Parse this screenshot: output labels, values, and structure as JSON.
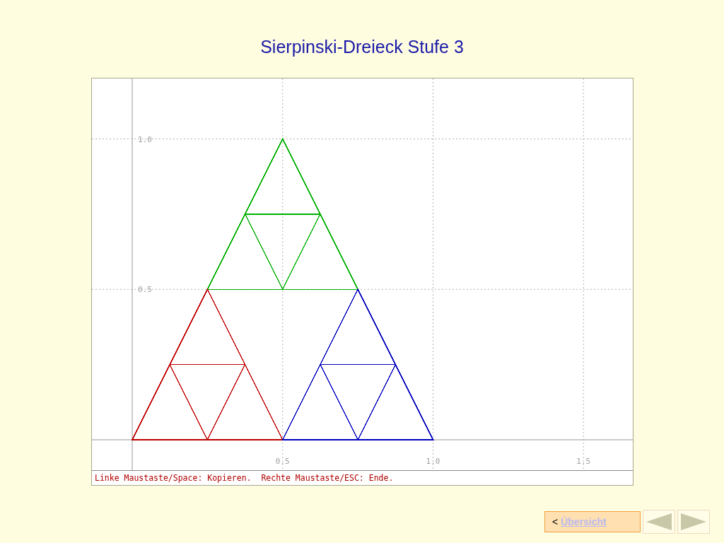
{
  "title": "Sierpinski-Dreieck Stufe 3",
  "plot": {
    "x_labels": [
      "0.5",
      "1.0",
      "1.5"
    ],
    "y_labels": [
      "1.0",
      "0.5"
    ],
    "triangles": [
      {
        "color": "#00b000"
      },
      {
        "color": "#c00000"
      },
      {
        "color": "#0000c0"
      }
    ],
    "status": "Linke Maustaste/Space: Kopieren.  Rechte Maustaste/ESC: Ende."
  },
  "nav": {
    "prefix": "<",
    "link": "Übersicht"
  }
}
